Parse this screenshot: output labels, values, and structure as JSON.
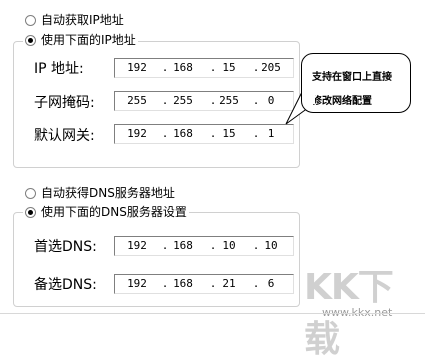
{
  "ip_section": {
    "auto_radio_label": "自动获取IP地址",
    "manual_radio_label": "使用下面的IP地址",
    "selected": "manual",
    "fields": [
      {
        "label": "IP 地址:",
        "octets": [
          "192",
          "168",
          "15",
          "205"
        ]
      },
      {
        "label": "子网掩码:",
        "octets": [
          "255",
          "255",
          "255",
          "0"
        ]
      },
      {
        "label": "默认网关:",
        "octets": [
          "192",
          "168",
          "15",
          "1"
        ]
      }
    ]
  },
  "dns_section": {
    "auto_radio_label": "自动获得DNS服务器地址",
    "manual_radio_label": "使用下面的DNS服务器设置",
    "selected": "manual",
    "fields": [
      {
        "label": "首选DNS:",
        "octets": [
          "192",
          "168",
          "10",
          "10"
        ]
      },
      {
        "label": "备选DNS:",
        "octets": [
          "192",
          "168",
          "21",
          "6"
        ]
      }
    ]
  },
  "callout": {
    "line1": "支持在窗口上直接",
    "line2": "修改网络配置"
  },
  "watermark": {
    "logo_text": "KK下载",
    "url": "www.kkx.net"
  }
}
